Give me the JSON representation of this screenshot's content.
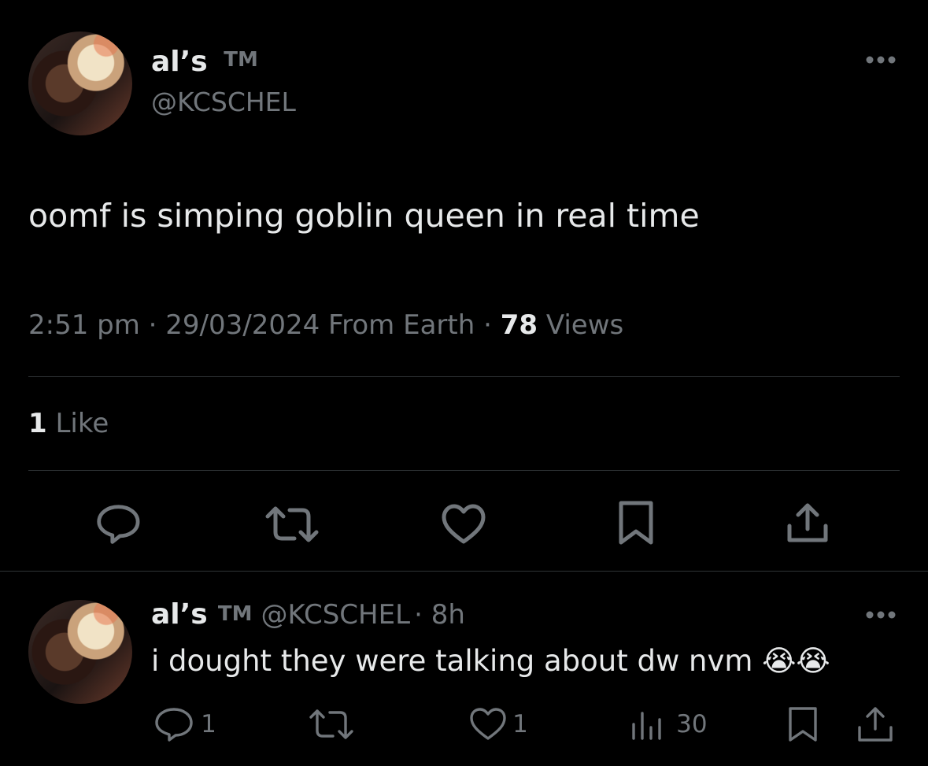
{
  "main_tweet": {
    "display_name": "al’s",
    "name_suffix": "TM",
    "handle": "@KCSCHEL",
    "text": "oomf is simping goblin queen in real time",
    "time": "2:51 pm · 29/03/2024 From Earth ·",
    "views_count": "78",
    "views_label": "Views",
    "likes_count": "1",
    "likes_label": "Like"
  },
  "reply": {
    "display_name": "al’s",
    "name_suffix": "TM",
    "handle": "@KCSCHEL",
    "age": "· 8h",
    "text": "i dought they were talking about dw nvm 😭😭",
    "reply_count": "1",
    "like_count": "1",
    "view_count": "30"
  },
  "colors": {
    "background": "#000000",
    "text": "#e7e9ea",
    "muted": "#71767b",
    "divider": "#2f3336"
  },
  "icons": [
    "more-icon",
    "reply-icon",
    "retweet-icon",
    "like-icon",
    "bookmark-icon",
    "share-icon",
    "views-icon"
  ]
}
